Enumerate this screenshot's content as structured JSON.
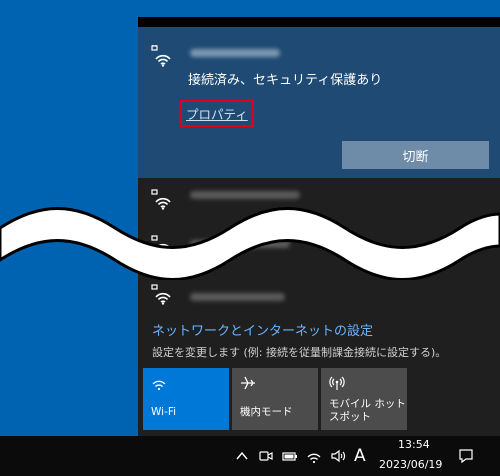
{
  "connected_network": {
    "status": "接続済み、セキュリティ保護あり",
    "properties_link": "プロパティ",
    "disconnect_label": "切断"
  },
  "settings": {
    "title": "ネットワークとインターネットの設定",
    "description": "設定を変更します (例: 接続を従量制課金接続に設定する)。"
  },
  "quick_actions": [
    {
      "label": "Wi-Fi",
      "icon": "wifi-icon",
      "active": true
    },
    {
      "label": "機内モード",
      "icon": "airplane-icon",
      "active": false
    },
    {
      "label": "モバイル ホットスポット",
      "icon": "hotspot-icon",
      "active": false
    }
  ],
  "taskbar": {
    "ime_label": "A",
    "time": "13:54",
    "date": "2023/06/19"
  },
  "colors": {
    "desktop": "#0063b1",
    "flyout": "#1f1f1f",
    "connected_bg": "#1e4a73",
    "accent": "#0078d7",
    "link": "#69b7ff",
    "highlight_box": "#e0001a"
  }
}
